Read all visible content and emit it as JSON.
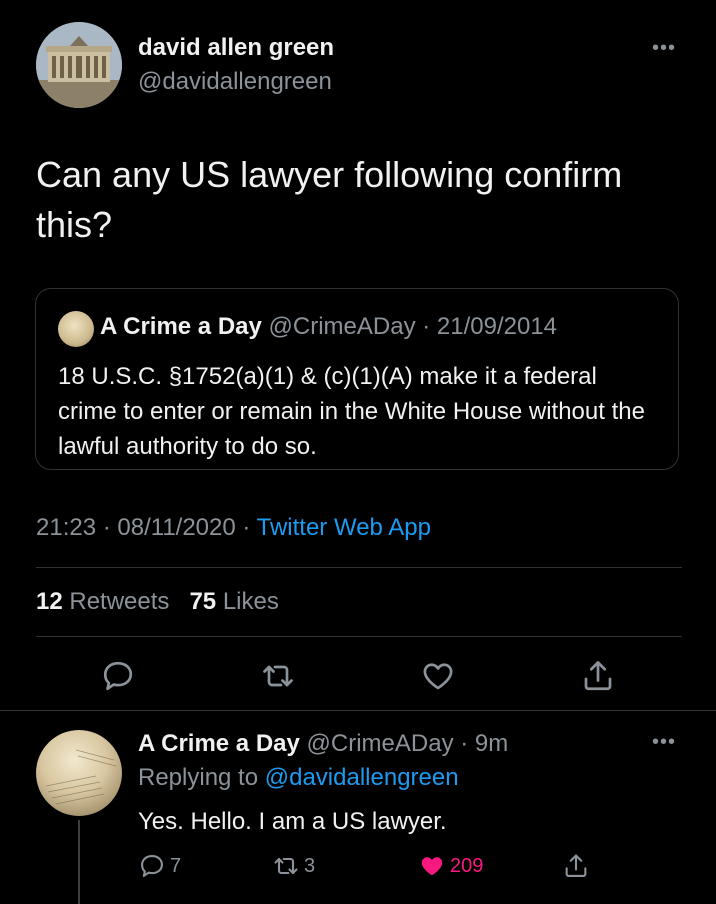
{
  "tweet": {
    "author_name": "david allen green",
    "author_handle": "@davidallengreen",
    "text": "Can any US lawyer following confirm this?",
    "timestamp": "21:23 · 08/11/2020 · ",
    "source": "Twitter Web App",
    "retweets_count": "12",
    "retweets_label": "Retweets",
    "likes_count": "75",
    "likes_label": "Likes"
  },
  "quoted": {
    "name": "A Crime a Day",
    "handle_date": "@CrimeADay · 21/09/2014",
    "text": "18 U.S.C. §1752(a)(1) & (c)(1)(A) make it a federal crime to enter or remain in the White House without the lawful authority to do so."
  },
  "actions": {
    "icons": [
      "reply-icon",
      "retweet-icon",
      "like-icon",
      "share-icon"
    ]
  },
  "reply": {
    "name": "A Crime a Day",
    "handle_time": "@CrimeADay · 9m",
    "replying_prefix": "Replying to ",
    "replying_to": "@davidallengreen",
    "text": "Yes. Hello. I am a US lawyer.",
    "reply_count": "7",
    "retweet_count": "3",
    "like_count": "209"
  },
  "colors": {
    "background": "#000000",
    "accent": "#1d9bf0",
    "like": "#f91880",
    "muted": "#8b9299"
  }
}
